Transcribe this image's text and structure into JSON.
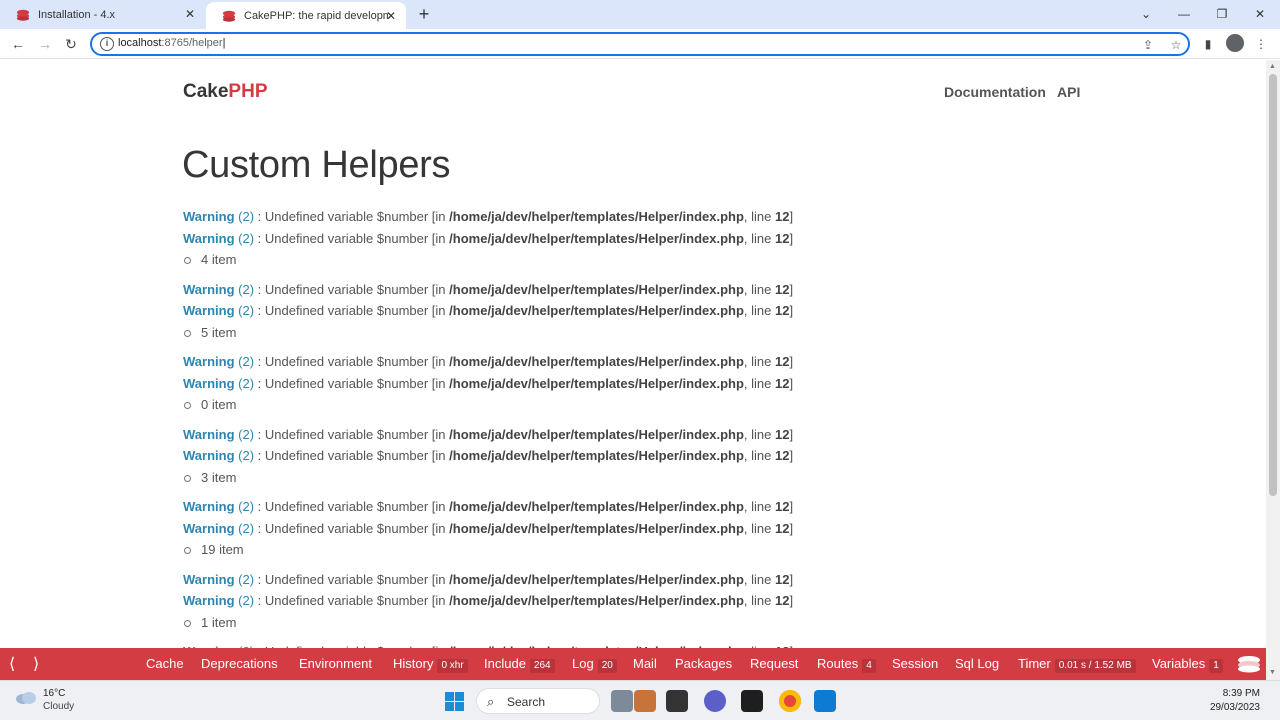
{
  "browser": {
    "tabs": [
      {
        "title": "Installation - 4.x"
      },
      {
        "title": "CakePHP: the rapid development php framework"
      }
    ],
    "url_host": "localhost",
    "url_rest": ":8765/helper"
  },
  "site": {
    "brand_a": "Cake",
    "brand_b": "PHP",
    "nav": [
      "Documentation",
      "API"
    ],
    "page_title": "Custom Helpers"
  },
  "warning": {
    "label": "Warning",
    "code": "(2)",
    "message": " : Undefined variable $number [in ",
    "file": "/home/ja/dev/helper/templates/Helper/index.php",
    "line_text": ", line ",
    "line_no": "12",
    "close": "]"
  },
  "items": [
    "4 item",
    "5 item",
    "0 item",
    "3 item",
    "19 item",
    "1 item"
  ],
  "debugkit": {
    "panels": [
      {
        "label": "Cache",
        "badge": ""
      },
      {
        "label": "Deprecations",
        "badge": ""
      },
      {
        "label": "Environment",
        "badge": ""
      },
      {
        "label": "History",
        "badge": "0 xhr"
      },
      {
        "label": "Include",
        "badge": "264"
      },
      {
        "label": "Log",
        "badge": "20"
      },
      {
        "label": "Mail",
        "badge": ""
      },
      {
        "label": "Packages",
        "badge": ""
      },
      {
        "label": "Request",
        "badge": ""
      },
      {
        "label": "Routes",
        "badge": "4"
      },
      {
        "label": "Session",
        "badge": ""
      },
      {
        "label": "Sql Log",
        "badge": ""
      },
      {
        "label": "Timer",
        "badge": "0.01 s / 1.52 MB"
      },
      {
        "label": "Variables",
        "badge": "1"
      }
    ]
  },
  "taskbar": {
    "temp": "16°C",
    "condition": "Cloudy",
    "search": "Search",
    "time": "8:39 PM",
    "date": "29/03/2023"
  },
  "colors": {
    "cake_red": "#d33c43",
    "warning_blue": "#2f85ae",
    "omnibox_focus": "#1a73e8"
  }
}
